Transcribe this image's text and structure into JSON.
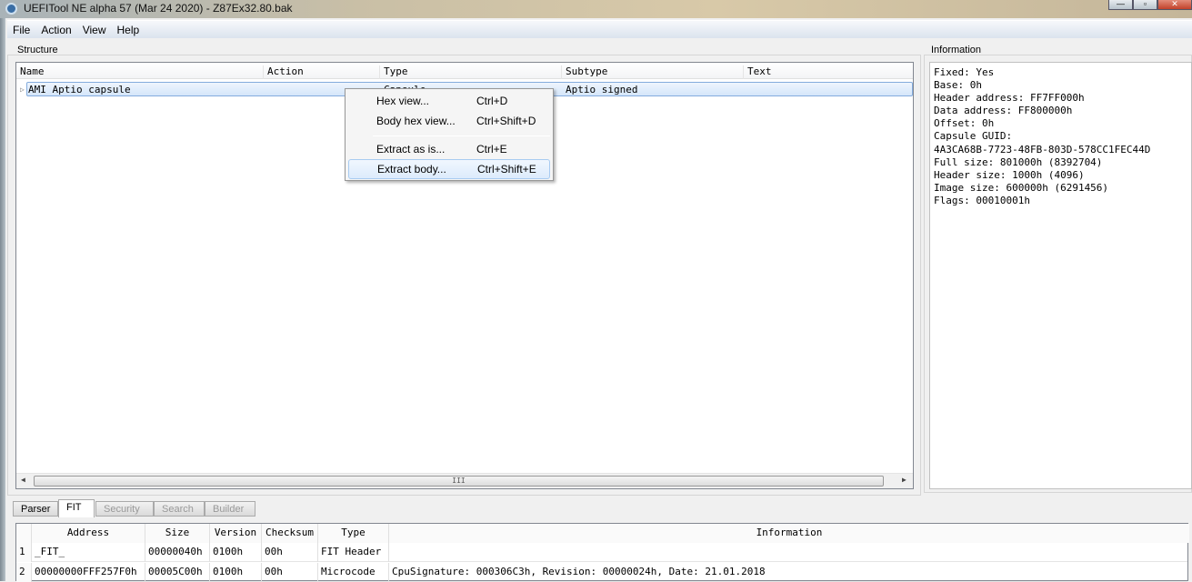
{
  "window": {
    "title": "UEFITool NE alpha 57 (Mar 24 2020) - Z87Ex32.80.bak",
    "minimize": "—",
    "maximize": "▫",
    "close": "✕"
  },
  "menu": [
    "File",
    "Action",
    "View",
    "Help"
  ],
  "structure": {
    "label": "Structure",
    "columns": [
      "Name",
      "Action",
      "Type",
      "Subtype",
      "Text"
    ],
    "rows": [
      {
        "name": "AMI Aptio capsule",
        "action": "",
        "type": "Capsule",
        "subtype": "Aptio signed",
        "text": ""
      }
    ]
  },
  "context_menu": [
    {
      "label": "Hex view...",
      "shortcut": "Ctrl+D"
    },
    {
      "label": "Body hex view...",
      "shortcut": "Ctrl+Shift+D"
    },
    {
      "label": "Extract as is...",
      "shortcut": "Ctrl+E"
    },
    {
      "label": "Extract body...",
      "shortcut": "Ctrl+Shift+E"
    }
  ],
  "information": {
    "label": "Information",
    "text": "Fixed: Yes\nBase: 0h\nHeader address: FF7FF000h\nData address: FF800000h\nOffset: 0h\nCapsule GUID:\n4A3CA68B-7723-48FB-803D-578CC1FEC44D\nFull size: 801000h (8392704)\nHeader size: 1000h (4096)\nImage size: 600000h (6291456)\nFlags: 00010001h"
  },
  "tabs": [
    "Parser",
    "FIT",
    "Security",
    "Search",
    "Builder"
  ],
  "fit": {
    "columns": [
      "",
      "Address",
      "Size",
      "Version",
      "Checksum",
      "Type",
      "Information"
    ],
    "rows": [
      [
        "1",
        "_FIT_",
        "00000040h",
        "0100h",
        "00h",
        "FIT Header",
        ""
      ],
      [
        "2",
        "00000000FFF257F0h",
        "00005C00h",
        "0100h",
        "00h",
        "Microcode",
        "CpuSignature: 000306C3h, Revision: 00000024h, Date: 21.01.2018"
      ]
    ]
  },
  "scroll_grip": "III"
}
